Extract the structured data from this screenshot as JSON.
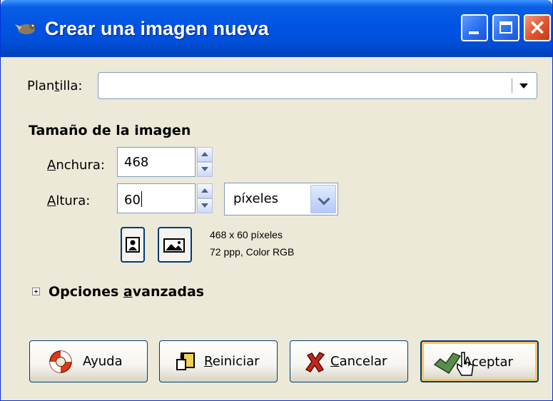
{
  "window": {
    "title": "Crear una imagen nueva",
    "icon": "gimp-wilber-icon",
    "controls": {
      "minimize": "minimize-icon",
      "maximize": "maximize-icon",
      "close": "×"
    }
  },
  "template": {
    "label": "Plantilla:",
    "value": ""
  },
  "image_size": {
    "heading": "Tamaño de la imagen",
    "width_label": "Anchura:",
    "width_value": "468",
    "height_label": "Altura:",
    "height_value": "60",
    "unit": "píxeles",
    "info_line1": "468 x 60 píxeles",
    "info_line2": "72 ppp, Color RGB"
  },
  "advanced": {
    "label": "Opciones avanzadas"
  },
  "buttons": {
    "help": "Ayuda",
    "reset": "Reiniciar",
    "cancel": "Cancelar",
    "ok": "Aceptar"
  },
  "colors": {
    "titlebar": "#0054e3",
    "dialog_bg": "#ece9d8",
    "default_button_glow": "#f5c563"
  }
}
